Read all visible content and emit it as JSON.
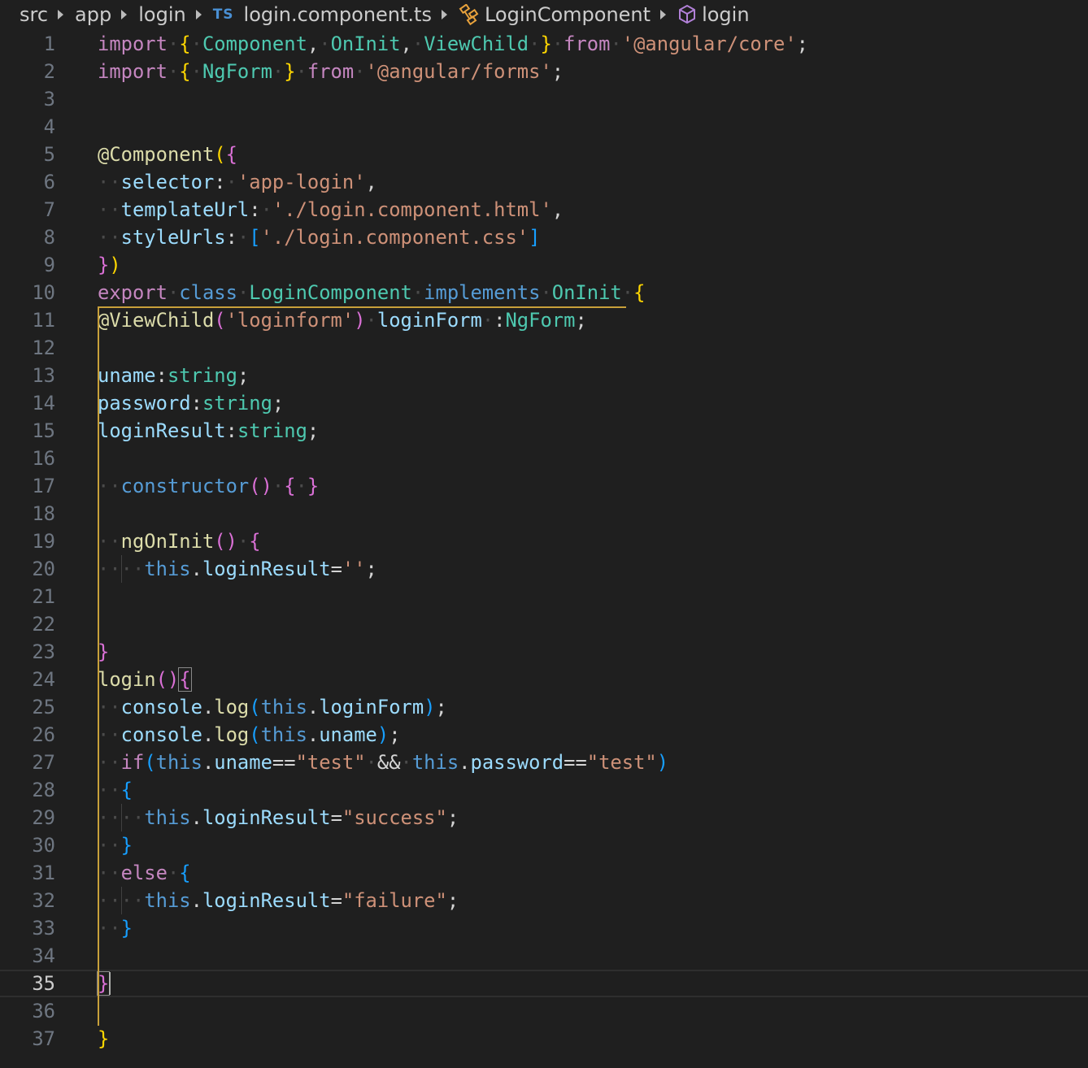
{
  "breadcrumb": {
    "items": [
      {
        "label": "src",
        "icon": ""
      },
      {
        "label": "app",
        "icon": ""
      },
      {
        "label": "login",
        "icon": ""
      },
      {
        "label": "login.component.ts",
        "icon": "typescript-file-icon",
        "badge": "TS"
      },
      {
        "label": "LoginComponent",
        "icon": "class-icon"
      },
      {
        "label": "login",
        "icon": "method-cube-icon"
      }
    ]
  },
  "editor": {
    "language": "typescript",
    "current_line": 35,
    "lines": [
      {
        "n": "1",
        "tokens": [
          [
            "kw",
            "import"
          ],
          [
            "ws",
            "·"
          ],
          [
            "br1",
            "{"
          ],
          [
            "ws",
            "·"
          ],
          [
            "ty",
            "Component"
          ],
          [
            "pu",
            ","
          ],
          [
            "ws",
            "·"
          ],
          [
            "ty",
            "OnInit"
          ],
          [
            "pu",
            ","
          ],
          [
            "ws",
            "·"
          ],
          [
            "ty",
            "ViewChild"
          ],
          [
            "ws",
            "·"
          ],
          [
            "br1",
            "}"
          ],
          [
            "ws",
            "·"
          ],
          [
            "kw",
            "from"
          ],
          [
            "ws",
            "·"
          ],
          [
            "st",
            "'@angular/core'"
          ],
          [
            "pu",
            ";"
          ]
        ]
      },
      {
        "n": "2",
        "tokens": [
          [
            "kw",
            "import"
          ],
          [
            "ws",
            "·"
          ],
          [
            "br1",
            "{"
          ],
          [
            "ws",
            "·"
          ],
          [
            "ty",
            "NgForm"
          ],
          [
            "ws",
            "·"
          ],
          [
            "br1",
            "}"
          ],
          [
            "ws",
            "·"
          ],
          [
            "kw",
            "from"
          ],
          [
            "ws",
            "·"
          ],
          [
            "st",
            "'@angular/forms'"
          ],
          [
            "pu",
            ";"
          ]
        ]
      },
      {
        "n": "3",
        "tokens": []
      },
      {
        "n": "4",
        "tokens": []
      },
      {
        "n": "5",
        "tokens": [
          [
            "fn",
            "@Component"
          ],
          [
            "br1",
            "("
          ],
          [
            "br2",
            "{"
          ]
        ]
      },
      {
        "n": "6",
        "tokens": [
          [
            "ws",
            "··"
          ],
          [
            "pm",
            "selector"
          ],
          [
            "pu",
            ":"
          ],
          [
            "ws",
            "·"
          ],
          [
            "st",
            "'app-login'"
          ],
          [
            "pu",
            ","
          ]
        ]
      },
      {
        "n": "7",
        "tokens": [
          [
            "ws",
            "··"
          ],
          [
            "pm",
            "templateUrl"
          ],
          [
            "pu",
            ":"
          ],
          [
            "ws",
            "·"
          ],
          [
            "st",
            "'./login.component.html'"
          ],
          [
            "pu",
            ","
          ]
        ]
      },
      {
        "n": "8",
        "tokens": [
          [
            "ws",
            "··"
          ],
          [
            "pm",
            "styleUrls"
          ],
          [
            "pu",
            ":"
          ],
          [
            "ws",
            "·"
          ],
          [
            "br3",
            "["
          ],
          [
            "st",
            "'./login.component.css'"
          ],
          [
            "br3",
            "]"
          ]
        ]
      },
      {
        "n": "9",
        "tokens": [
          [
            "br2",
            "}"
          ],
          [
            "br1",
            ")"
          ]
        ]
      },
      {
        "n": "10",
        "tokens": [
          [
            "kw",
            "export"
          ],
          [
            "ws",
            "·"
          ],
          [
            "bl",
            "class"
          ],
          [
            "ws",
            "·"
          ],
          [
            "ty",
            "LoginComponent"
          ],
          [
            "ws",
            "·"
          ],
          [
            "bl",
            "implements"
          ],
          [
            "ws",
            "·"
          ],
          [
            "ty",
            "OnInit"
          ],
          [
            "ws",
            "·"
          ],
          [
            "br1",
            "{"
          ]
        ]
      },
      {
        "n": "11",
        "tokens": [
          [
            "fn",
            "@ViewChild"
          ],
          [
            "br2",
            "("
          ],
          [
            "st",
            "'loginform'"
          ],
          [
            "br2",
            ")"
          ],
          [
            "ws",
            "·"
          ],
          [
            "pm",
            "loginForm"
          ],
          [
            "ws",
            "·"
          ],
          [
            "pu",
            ":"
          ],
          [
            "ty",
            "NgForm"
          ],
          [
            "pu",
            ";"
          ]
        ]
      },
      {
        "n": "12",
        "tokens": []
      },
      {
        "n": "13",
        "tokens": [
          [
            "pm",
            "uname"
          ],
          [
            "pu",
            ":"
          ],
          [
            "ty",
            "string"
          ],
          [
            "pu",
            ";"
          ]
        ]
      },
      {
        "n": "14",
        "tokens": [
          [
            "pm",
            "password"
          ],
          [
            "pu",
            ":"
          ],
          [
            "ty",
            "string"
          ],
          [
            "pu",
            ";"
          ]
        ]
      },
      {
        "n": "15",
        "tokens": [
          [
            "pm",
            "loginResult"
          ],
          [
            "pu",
            ":"
          ],
          [
            "ty",
            "string"
          ],
          [
            "pu",
            ";"
          ]
        ]
      },
      {
        "n": "16",
        "tokens": []
      },
      {
        "n": "17",
        "tokens": [
          [
            "ws",
            "··"
          ],
          [
            "bl",
            "constructor"
          ],
          [
            "br2",
            "()"
          ],
          [
            "ws",
            "·"
          ],
          [
            "br2",
            "{"
          ],
          [
            "ws",
            "·"
          ],
          [
            "br2",
            "}"
          ]
        ]
      },
      {
        "n": "18",
        "tokens": []
      },
      {
        "n": "19",
        "tokens": [
          [
            "ws",
            "··"
          ],
          [
            "fn",
            "ngOnInit"
          ],
          [
            "br2",
            "()"
          ],
          [
            "ws",
            "·"
          ],
          [
            "br2",
            "{"
          ]
        ]
      },
      {
        "n": "20",
        "tokens": [
          [
            "ws",
            "····"
          ],
          [
            "bl",
            "this"
          ],
          [
            "pu",
            "."
          ],
          [
            "pm",
            "loginResult"
          ],
          [
            "pu",
            "="
          ],
          [
            "st",
            "''"
          ],
          [
            "pu",
            ";"
          ]
        ]
      },
      {
        "n": "21",
        "tokens": []
      },
      {
        "n": "22",
        "tokens": []
      },
      {
        "n": "23",
        "tokens": [
          [
            "br2",
            "}"
          ]
        ]
      },
      {
        "n": "24",
        "tokens": [
          [
            "fn",
            "login"
          ],
          [
            "br2",
            "()"
          ],
          [
            "br2",
            "{"
          ]
        ]
      },
      {
        "n": "25",
        "tokens": [
          [
            "ws",
            "··"
          ],
          [
            "pm",
            "console"
          ],
          [
            "pu",
            "."
          ],
          [
            "fn",
            "log"
          ],
          [
            "br3",
            "("
          ],
          [
            "bl",
            "this"
          ],
          [
            "pu",
            "."
          ],
          [
            "pm",
            "loginForm"
          ],
          [
            "br3",
            ")"
          ],
          [
            "pu",
            ";"
          ]
        ]
      },
      {
        "n": "26",
        "tokens": [
          [
            "ws",
            "··"
          ],
          [
            "pm",
            "console"
          ],
          [
            "pu",
            "."
          ],
          [
            "fn",
            "log"
          ],
          [
            "br3",
            "("
          ],
          [
            "bl",
            "this"
          ],
          [
            "pu",
            "."
          ],
          [
            "pm",
            "uname"
          ],
          [
            "br3",
            ")"
          ],
          [
            "pu",
            ";"
          ]
        ]
      },
      {
        "n": "27",
        "tokens": [
          [
            "ws",
            "··"
          ],
          [
            "kw",
            "if"
          ],
          [
            "br3",
            "("
          ],
          [
            "bl",
            "this"
          ],
          [
            "pu",
            "."
          ],
          [
            "pm",
            "uname"
          ],
          [
            "pu",
            "=="
          ],
          [
            "st",
            "\"test\""
          ],
          [
            "ws",
            "·"
          ],
          [
            "pu",
            "&&"
          ],
          [
            "ws",
            "·"
          ],
          [
            "bl",
            "this"
          ],
          [
            "pu",
            "."
          ],
          [
            "pm",
            "password"
          ],
          [
            "pu",
            "=="
          ],
          [
            "st",
            "\"test\""
          ],
          [
            "br3",
            ")"
          ]
        ]
      },
      {
        "n": "28",
        "tokens": [
          [
            "ws",
            "··"
          ],
          [
            "br3",
            "{"
          ]
        ]
      },
      {
        "n": "29",
        "tokens": [
          [
            "ws",
            "····"
          ],
          [
            "bl",
            "this"
          ],
          [
            "pu",
            "."
          ],
          [
            "pm",
            "loginResult"
          ],
          [
            "pu",
            "="
          ],
          [
            "st",
            "\"success\""
          ],
          [
            "pu",
            ";"
          ]
        ]
      },
      {
        "n": "30",
        "tokens": [
          [
            "ws",
            "··"
          ],
          [
            "br3",
            "}"
          ]
        ]
      },
      {
        "n": "31",
        "tokens": [
          [
            "ws",
            "··"
          ],
          [
            "kw",
            "else"
          ],
          [
            "ws",
            "·"
          ],
          [
            "br3",
            "{"
          ]
        ]
      },
      {
        "n": "32",
        "tokens": [
          [
            "ws",
            "····"
          ],
          [
            "bl",
            "this"
          ],
          [
            "pu",
            "."
          ],
          [
            "pm",
            "loginResult"
          ],
          [
            "pu",
            "="
          ],
          [
            "st",
            "\"failure\""
          ],
          [
            "pu",
            ";"
          ]
        ]
      },
      {
        "n": "33",
        "tokens": [
          [
            "ws",
            "··"
          ],
          [
            "br3",
            "}"
          ]
        ]
      },
      {
        "n": "34",
        "tokens": []
      },
      {
        "n": "35",
        "tokens": [
          [
            "br2",
            "}"
          ]
        ]
      },
      {
        "n": "36",
        "tokens": []
      },
      {
        "n": "37",
        "tokens": [
          [
            "br1",
            "}"
          ]
        ]
      }
    ]
  },
  "colors": {
    "background": "#1f1f1f",
    "keyword": "#c586c0",
    "string": "#ce9178",
    "function": "#dcdcaa",
    "type": "#4ec9b0",
    "property": "#9cdcfe",
    "storage": "#569cd6",
    "bracket_gold": "#ffd700",
    "bracket_orchid": "#da70d6",
    "bracket_blue": "#179fff",
    "scope_guide": "#c8a03a"
  }
}
